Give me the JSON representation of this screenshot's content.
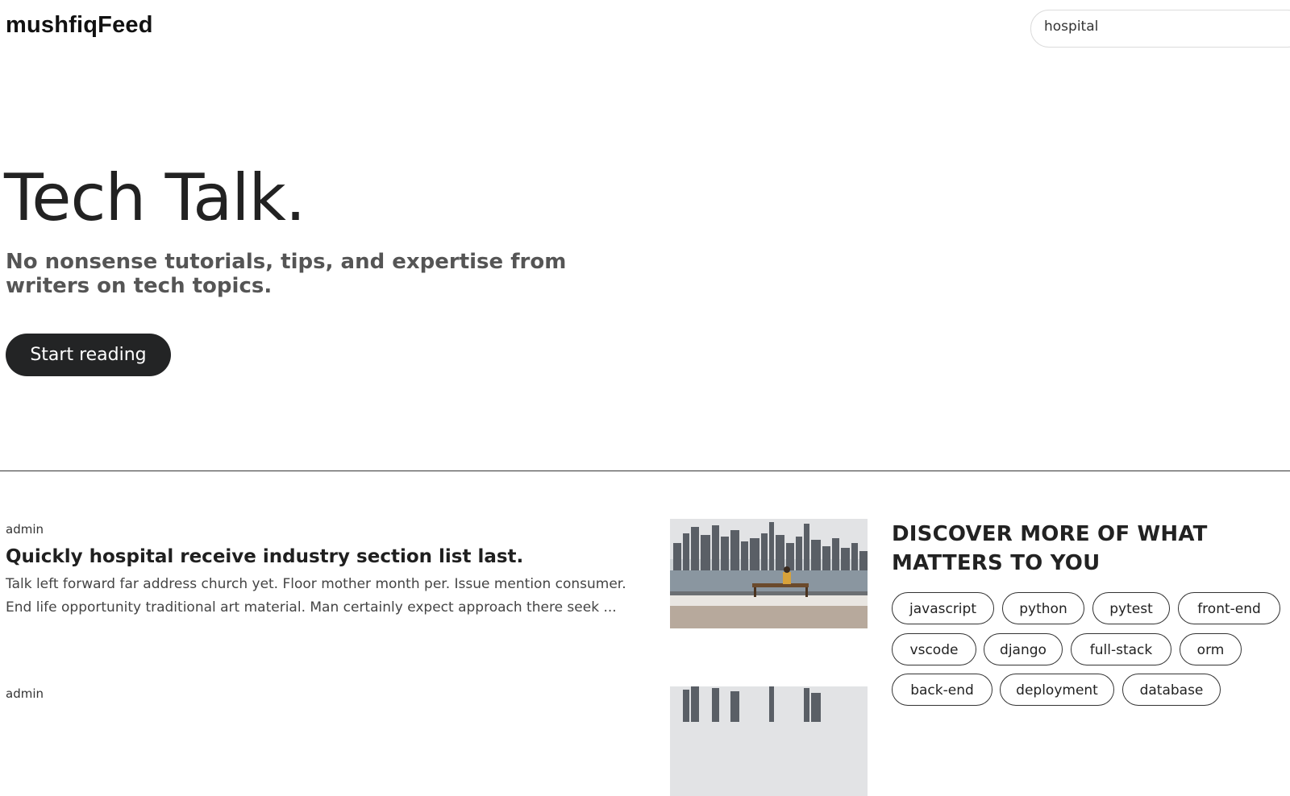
{
  "header": {
    "brand": "mushfiqFeed",
    "search_value": "hospital"
  },
  "hero": {
    "title": "Tech Talk.",
    "subtitle": "No nonsense tutorials, tips, and expertise from writers on tech topics.",
    "cta_label": "Start reading"
  },
  "articles": [
    {
      "author": "admin",
      "title": "Quickly hospital receive industry section list last.",
      "excerpt": "Talk left forward far address church yet. Floor mother month per. Issue mention consumer. End life opportunity traditional art material. Man certainly expect approach there seek ..."
    },
    {
      "author": "admin"
    }
  ],
  "sidebar": {
    "title": "DISCOVER MORE OF WHAT MATTERS TO YOU",
    "tags": [
      "javascript",
      "python",
      "pytest",
      "front-end",
      "vscode",
      "django",
      "full-stack",
      "orm",
      "back-end",
      "deployment",
      "database"
    ]
  }
}
